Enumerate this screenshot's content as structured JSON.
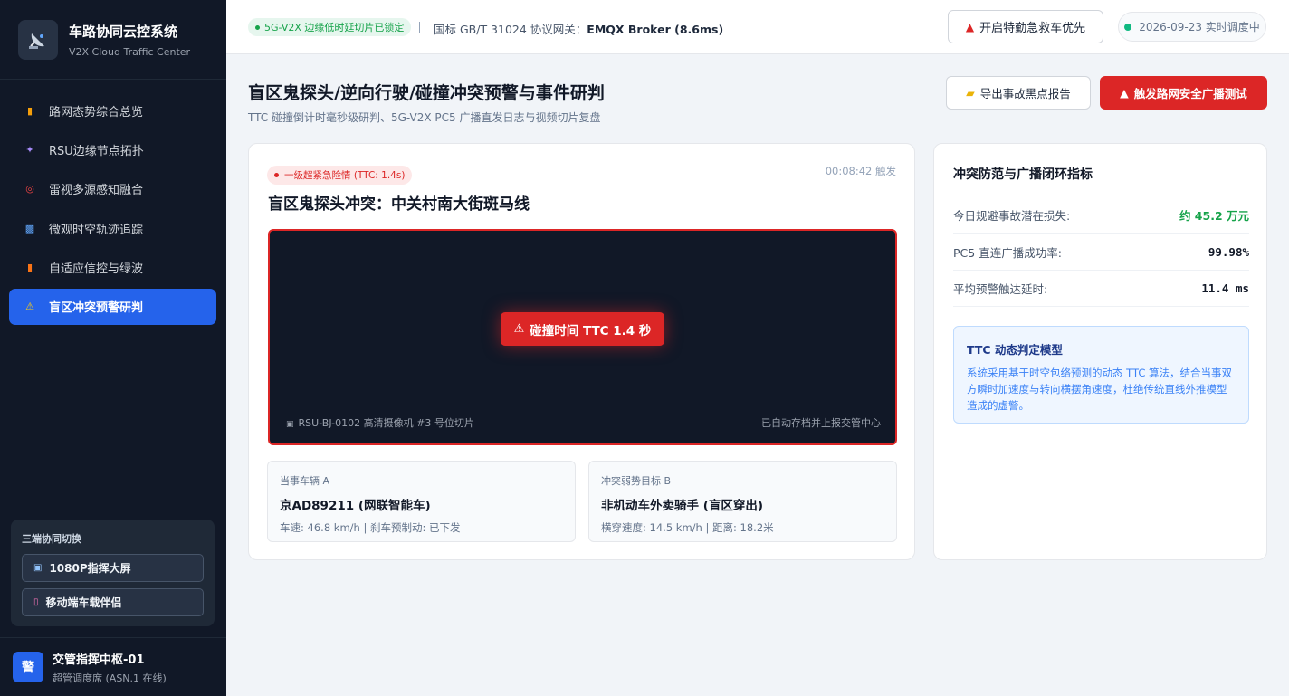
{
  "brand": {
    "title": "车路协同云控系统",
    "subtitle": "V2X Cloud Traffic Center",
    "icon": "satellite-dish-icon"
  },
  "nav": [
    {
      "label": "路网态势综合总览",
      "icon": "chart-icon",
      "glyph": "▮",
      "color": "#f59e0b"
    },
    {
      "label": "RSU边缘节点拓扑",
      "icon": "satellite-icon",
      "glyph": "✦",
      "color": "#a78bfa"
    },
    {
      "label": "雷视多源感知融合",
      "icon": "target-icon",
      "glyph": "◎",
      "color": "#ef4444"
    },
    {
      "label": "微观时空轨迹追踪",
      "icon": "map-icon",
      "glyph": "▩",
      "color": "#60a5fa"
    },
    {
      "label": "自适应信控与绿波",
      "icon": "traffic-light-icon",
      "glyph": "▮",
      "color": "#f97316"
    },
    {
      "label": "盲区冲突预警研判",
      "icon": "warning-icon",
      "glyph": "⚠",
      "color": "#facc15",
      "active": true
    }
  ],
  "switch_panel": {
    "title": "三端协同切换",
    "buttons": [
      {
        "label": "1080P指挥大屏",
        "icon": "monitor-icon",
        "glyph": "▣"
      },
      {
        "label": "移动端车载伴侣",
        "icon": "phone-icon",
        "glyph": "▯"
      }
    ]
  },
  "user": {
    "avatar": "警",
    "name": "交管指挥中枢-01",
    "role": "超管调度席 (ASN.1 在线)"
  },
  "topbar": {
    "status_pill": "5G-V2X 边缘低时延切片已锁定",
    "gateway_label": "国标 GB/T 31024 协议网关：",
    "gateway_value": "EMQX Broker (8.6ms)",
    "emergency_button": "开启特勤急救车优先",
    "date_status": "2026-09-23 实时调度中"
  },
  "header": {
    "title": "盲区鬼探头/逆向行驶/碰撞冲突预警与事件研判",
    "subtitle": "TTC 碰撞倒计时毫秒级研判、5G-V2X PC5 广播直发日志与视频切片复盘",
    "export_button": "导出事故黑点报告",
    "broadcast_button": "触发路网安全广播测试"
  },
  "event": {
    "badge": "一级超紧急险情 (TTC: 1.4s)",
    "time": "00:08:42 触发",
    "title": "盲区鬼探头冲突：中关村南大街斑马线",
    "ttc_label": "碰撞时间 TTC 1.4 秒",
    "video_source": "RSU-BJ-0102 高清摄像机 #3 号位切片",
    "video_archive": "已自动存档并上报交管中心",
    "party_a": {
      "label": "当事车辆 A",
      "name": "京AD89211 (网联智能车)",
      "detail": "车速: 46.8 km/h | 刹车预制动: 已下发"
    },
    "party_b": {
      "label": "冲突弱势目标 B",
      "name": "非机动车外卖骑手 (盲区穿出)",
      "detail": "横穿速度: 14.5 km/h | 距离: 18.2米"
    }
  },
  "metrics": {
    "title": "冲突防范与广播闭环指标",
    "items": [
      {
        "label": "今日规避事故潜在损失:",
        "value": "约 45.2 万元"
      },
      {
        "label": "PC5 直连广播成功率:",
        "value": "99.98%"
      },
      {
        "label": "平均预警触达延时:",
        "value": "11.4 ms"
      }
    ],
    "model_title": "TTC 动态判定模型",
    "model_text": "系统采用基于时空包络预测的动态 TTC 算法，结合当事双方瞬时加速度与转向横摆角速度，杜绝传统直线外推模型造成的虚警。"
  },
  "colors": {
    "sidebar": "#111827",
    "accent": "#2563eb",
    "danger": "#dc2626",
    "success": "#16a34a"
  }
}
